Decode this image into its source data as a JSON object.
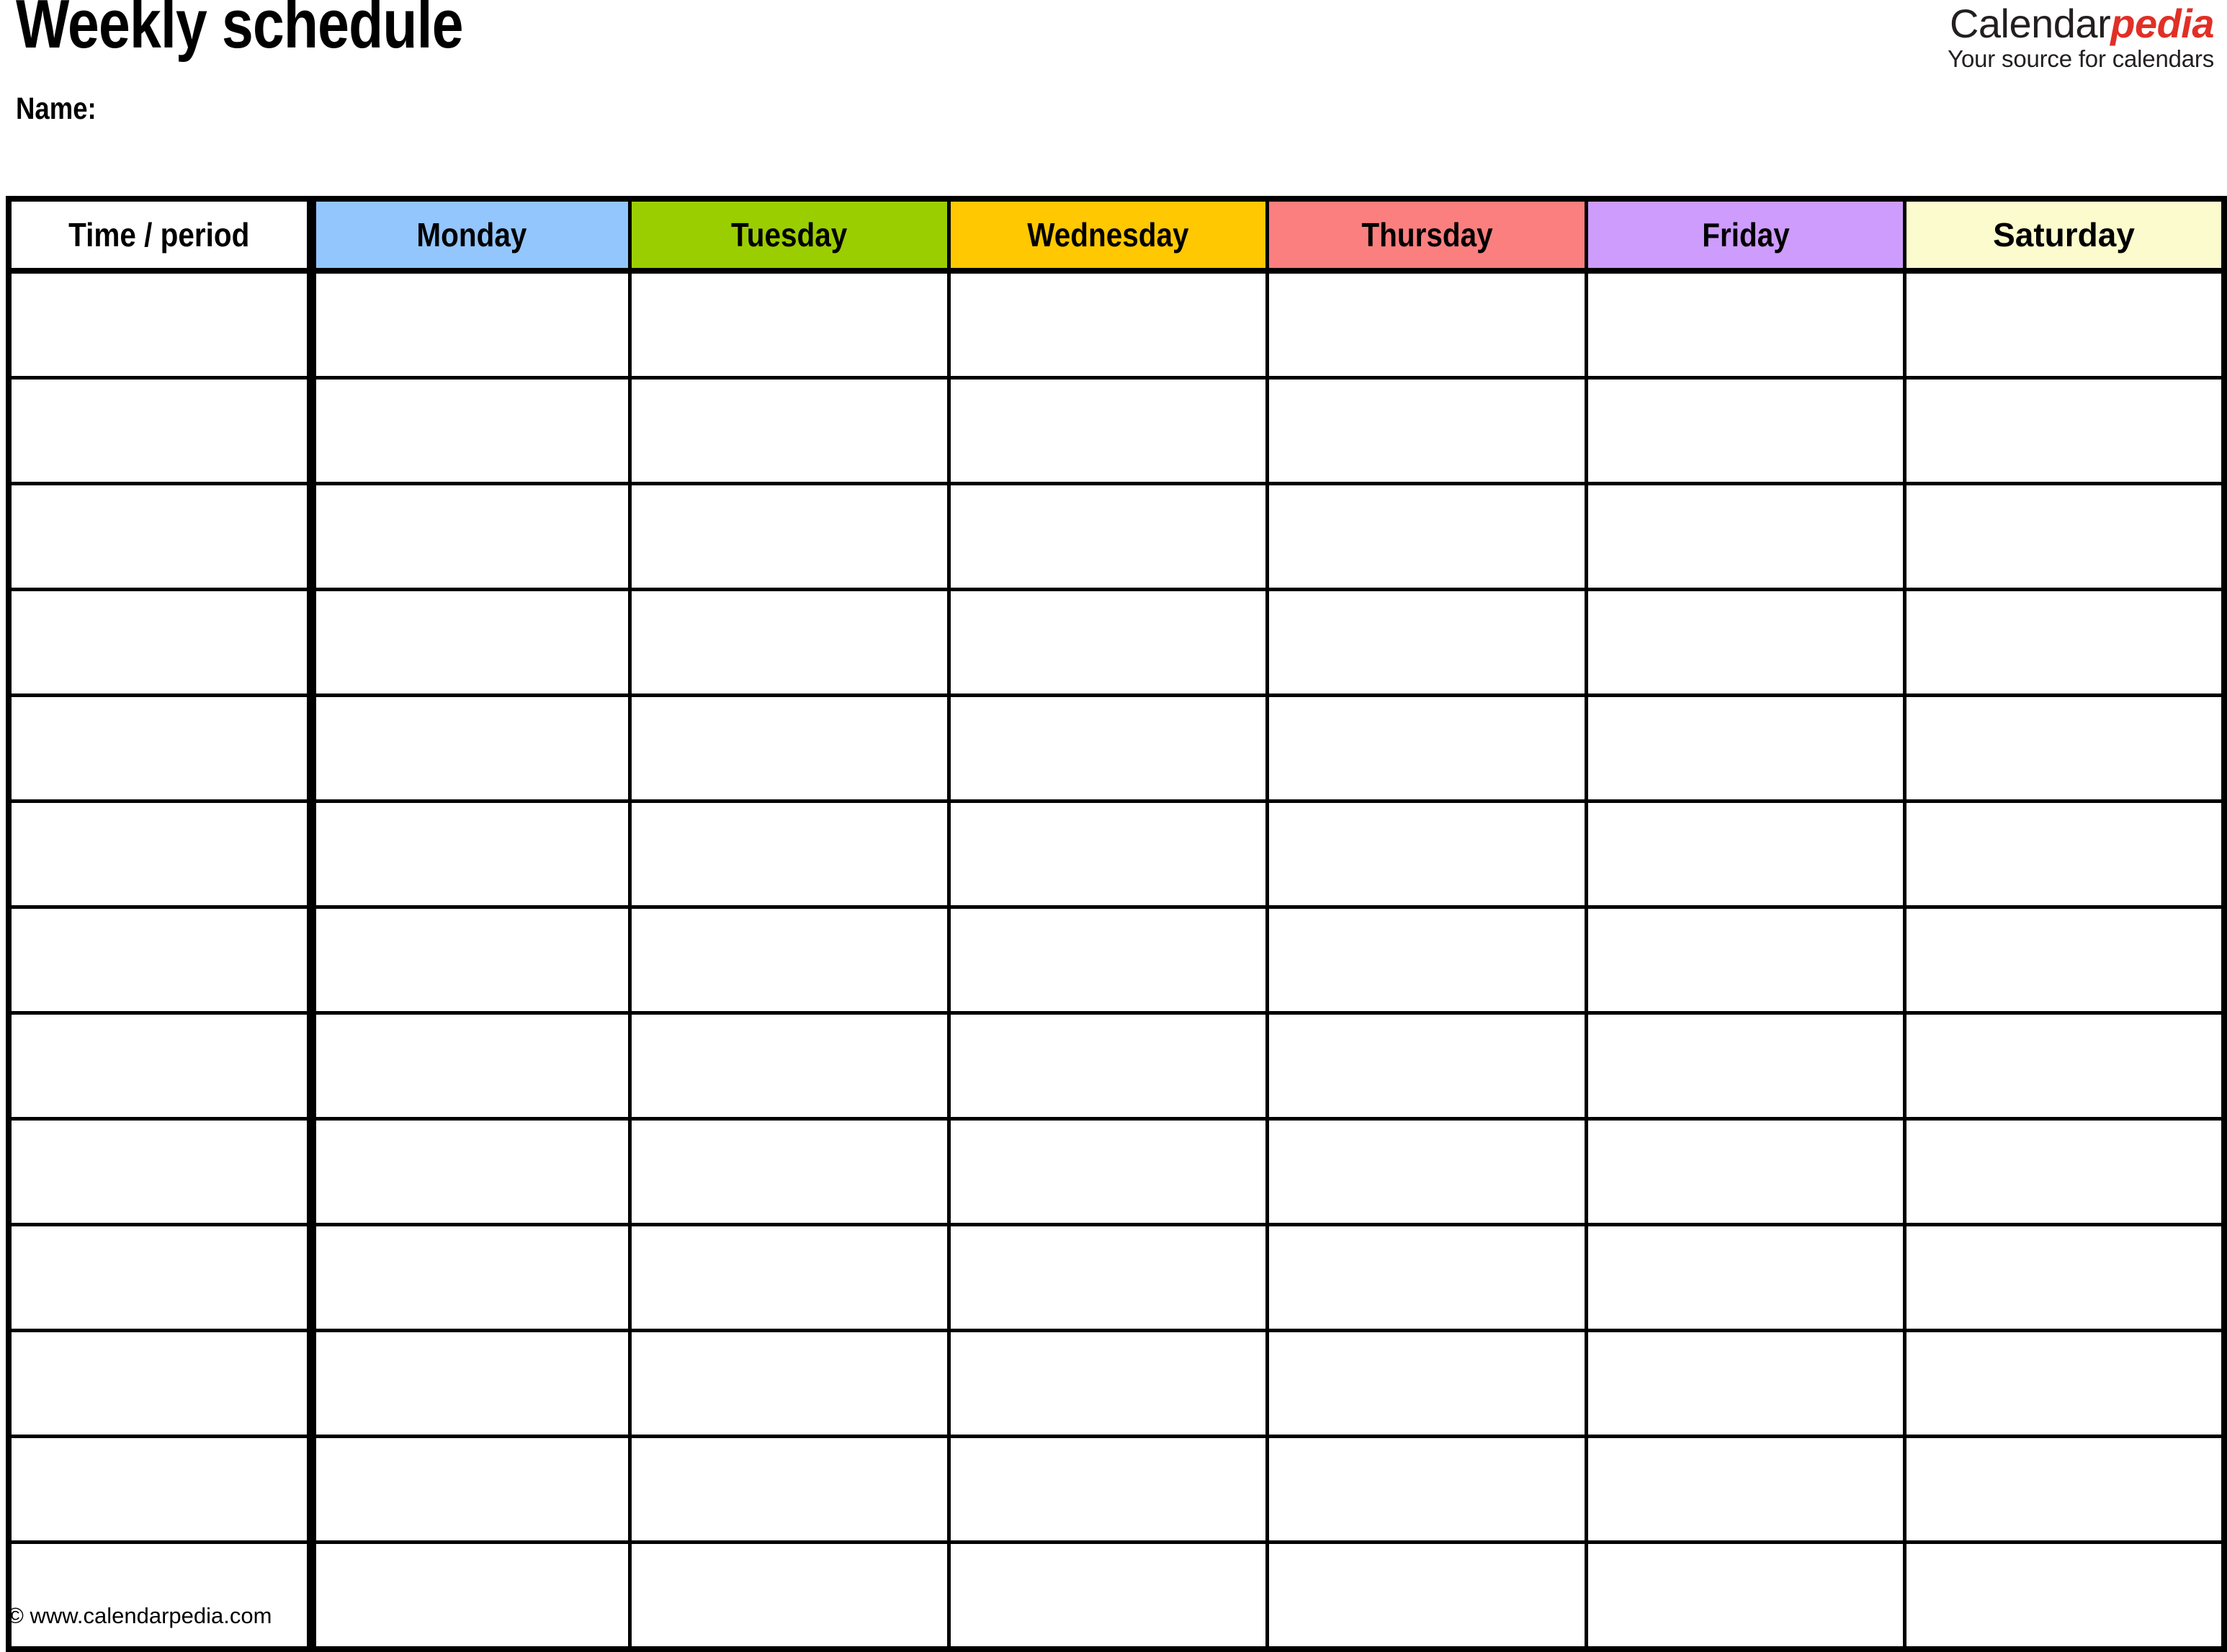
{
  "header": {
    "title": "Weekly schedule",
    "name_label": "Name:"
  },
  "brand": {
    "word_primary": "Calendar",
    "word_accent": "pedia",
    "tagline": "Your source for calendars",
    "accent_color": "#e12f26",
    "primary_color": "#231f20"
  },
  "table": {
    "columns": [
      {
        "label": "Time / period",
        "bg": "#ffffff"
      },
      {
        "label": "Monday",
        "bg": "#93c6fd"
      },
      {
        "label": "Tuesday",
        "bg": "#9bce00"
      },
      {
        "label": "Wednesday",
        "bg": "#ffc800"
      },
      {
        "label": "Thursday",
        "bg": "#fb7f7f"
      },
      {
        "label": "Friday",
        "bg": "#ce9cfc"
      },
      {
        "label": "Saturday",
        "bg": "#fcfbcd"
      }
    ],
    "row_count": 13,
    "rows": [
      {
        "time": "",
        "cells": [
          "",
          "",
          "",
          "",
          "",
          ""
        ]
      },
      {
        "time": "",
        "cells": [
          "",
          "",
          "",
          "",
          "",
          ""
        ]
      },
      {
        "time": "",
        "cells": [
          "",
          "",
          "",
          "",
          "",
          ""
        ]
      },
      {
        "time": "",
        "cells": [
          "",
          "",
          "",
          "",
          "",
          ""
        ]
      },
      {
        "time": "",
        "cells": [
          "",
          "",
          "",
          "",
          "",
          ""
        ]
      },
      {
        "time": "",
        "cells": [
          "",
          "",
          "",
          "",
          "",
          ""
        ]
      },
      {
        "time": "",
        "cells": [
          "",
          "",
          "",
          "",
          "",
          ""
        ]
      },
      {
        "time": "",
        "cells": [
          "",
          "",
          "",
          "",
          "",
          ""
        ]
      },
      {
        "time": "",
        "cells": [
          "",
          "",
          "",
          "",
          "",
          ""
        ]
      },
      {
        "time": "",
        "cells": [
          "",
          "",
          "",
          "",
          "",
          ""
        ]
      },
      {
        "time": "",
        "cells": [
          "",
          "",
          "",
          "",
          "",
          ""
        ]
      },
      {
        "time": "",
        "cells": [
          "",
          "",
          "",
          "",
          "",
          ""
        ]
      },
      {
        "time": "",
        "cells": [
          "",
          "",
          "",
          "",
          "",
          ""
        ]
      }
    ]
  },
  "footer": {
    "copyright": "© www.calendarpedia.com"
  }
}
